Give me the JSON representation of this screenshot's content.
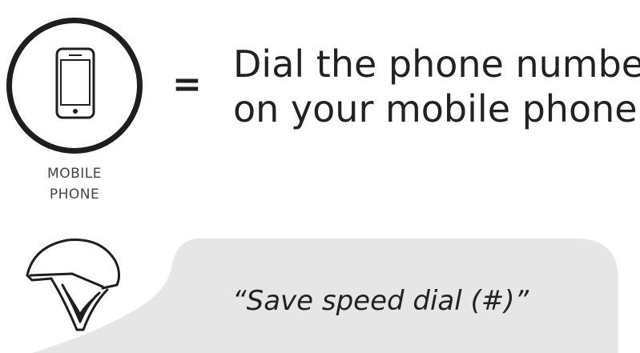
{
  "device": {
    "icon": "mobile-phone-icon",
    "label_lines": [
      "MOBILE",
      "PHONE"
    ]
  },
  "operator": "=",
  "instruction": {
    "lines": [
      "Dial the phone number",
      "on your mobile phone"
    ]
  },
  "voice": {
    "icon": "helmet-icon",
    "command": "“Save speed dial (#)”"
  },
  "colors": {
    "ink": "#1e1e1e",
    "label": "#444444",
    "bubble": "#e6e6e6"
  }
}
